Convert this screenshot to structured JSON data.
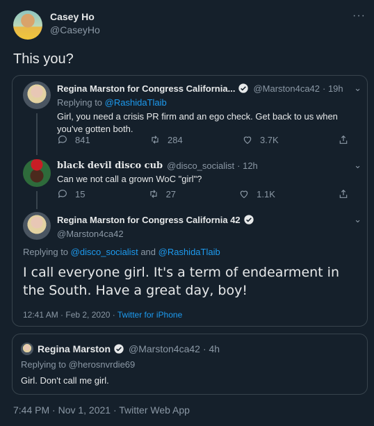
{
  "tweet": {
    "author_name": "Casey Ho",
    "author_handle": "@CaseyHo",
    "text": "This you?",
    "timestamp": "7:44 PM · Nov 1, 2021 · Twitter Web App"
  },
  "quoted_thread": {
    "reply1": {
      "name": "Regina Marston for Congress California...",
      "handle": "@Marston4ca42",
      "time": "· 19h",
      "replying_prefix": "Replying to",
      "replying_to": "@RashidaTlaib",
      "text": "Girl, you need a crisis PR firm and an ego check. Get back to us when you've gotten both.",
      "counts": {
        "replies": "841",
        "retweets": "284",
        "likes": "3.7K"
      }
    },
    "reply2": {
      "name": "black devil disco cub",
      "handle": "@disco_socialist",
      "time": "· 12h",
      "text": "Can we not call a grown WoC \"girl\"?",
      "counts": {
        "replies": "15",
        "retweets": "27",
        "likes": "1.1K"
      }
    },
    "main": {
      "name": "Regina Marston for Congress California 42",
      "handle": "@Marston4ca42",
      "replying_prefix": "Replying to",
      "replying_to_1": "@disco_socialist",
      "replying_and": "and",
      "replying_to_2": "@RashidaTlaib",
      "text": "I call everyone girl. It's a term of endearment in the South. Have a great day, boy!",
      "timestamp": "12:41 AM · Feb 2, 2020 ·",
      "source": "Twitter for iPhone"
    }
  },
  "quote_card": {
    "name": "Regina Marston",
    "handle": "@Marston4ca42",
    "time": "· 4h",
    "replying_prefix": "Replying to",
    "replying_to": "@herosnvrdie69",
    "text": "Girl. Don't call me girl."
  },
  "colors": {
    "background": "#15202b",
    "border": "#38444d",
    "accent": "#1d9bf0",
    "muted": "#8b98a5"
  },
  "icons": [
    "more-icon",
    "verified-icon",
    "reply-icon",
    "retweet-icon",
    "like-icon",
    "share-icon",
    "chevron-down-icon"
  ]
}
